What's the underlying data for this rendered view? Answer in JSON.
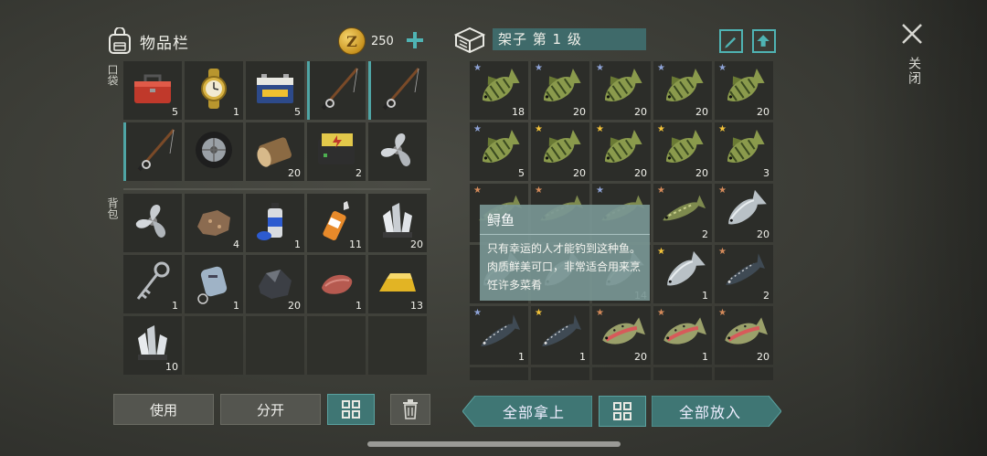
{
  "inventory": {
    "title": "物品栏",
    "coins": "250",
    "coin_symbol": "Z",
    "pocket_label": "口袋",
    "backpack_label": "背包",
    "pocket_items": [
      {
        "icon": "toolbox-icon",
        "count": "5"
      },
      {
        "icon": "wristwatch-icon",
        "count": "1"
      },
      {
        "icon": "battery-icon",
        "count": "5"
      },
      {
        "icon": "fishing-rod-icon",
        "count": ""
      },
      {
        "icon": "fishing-rod-icon",
        "count": ""
      },
      {
        "icon": "fishing-rod-icon",
        "count": ""
      },
      {
        "icon": "wheel-icon",
        "count": ""
      },
      {
        "icon": "log-icon",
        "count": "20"
      },
      {
        "icon": "electronic-device-icon",
        "count": "2"
      },
      {
        "icon": "propeller-icon",
        "count": ""
      }
    ],
    "backpack_items": [
      {
        "icon": "propeller-icon",
        "count": ""
      },
      {
        "icon": "ore-rock-icon",
        "count": "4"
      },
      {
        "icon": "spray-can-icon",
        "count": "1"
      },
      {
        "icon": "glue-bottle-icon",
        "count": "11"
      },
      {
        "icon": "crystal-icon",
        "count": "20"
      },
      {
        "icon": "key-icon",
        "count": "1"
      },
      {
        "icon": "dog-tag-icon",
        "count": "1"
      },
      {
        "icon": "coal-icon",
        "count": "20"
      },
      {
        "icon": "sausage-icon",
        "count": "1"
      },
      {
        "icon": "gold-bar-icon",
        "count": "13"
      },
      {
        "icon": "crystal-icon",
        "count": "10"
      },
      {
        "icon": "",
        "count": ""
      },
      {
        "icon": "",
        "count": ""
      },
      {
        "icon": "",
        "count": ""
      },
      {
        "icon": "",
        "count": ""
      }
    ],
    "buttons": {
      "use": "使用",
      "split": "分开"
    }
  },
  "shelf": {
    "title": "架子 第 1 级",
    "items": [
      {
        "fish": "perch",
        "star": "blue",
        "count": "18"
      },
      {
        "fish": "perch",
        "star": "blue",
        "count": "20"
      },
      {
        "fish": "perch",
        "star": "blue",
        "count": "20"
      },
      {
        "fish": "perch",
        "star": "blue",
        "count": "20"
      },
      {
        "fish": "perch",
        "star": "blue",
        "count": "20"
      },
      {
        "fish": "perch",
        "star": "blue",
        "count": "5"
      },
      {
        "fish": "perch",
        "star": "gold",
        "count": "20"
      },
      {
        "fish": "perch",
        "star": "gold",
        "count": "20"
      },
      {
        "fish": "perch",
        "star": "gold",
        "count": "20"
      },
      {
        "fish": "perch",
        "star": "gold",
        "count": "3"
      },
      {
        "fish": "pike",
        "star": "bronze",
        "count": ""
      },
      {
        "fish": "pike",
        "star": "bronze",
        "count": ""
      },
      {
        "fish": "pike",
        "star": "blue",
        "count": ""
      },
      {
        "fish": "pike",
        "star": "bronze",
        "count": "2"
      },
      {
        "fish": "salmon",
        "star": "bronze",
        "count": "20"
      },
      {
        "fish": "salmon",
        "star": "",
        "count": ""
      },
      {
        "fish": "salmon",
        "star": "",
        "count": ""
      },
      {
        "fish": "salmon",
        "star": "",
        "count": "14"
      },
      {
        "fish": "salmon",
        "star": "gold",
        "count": "1"
      },
      {
        "fish": "sturgeon",
        "star": "bronze",
        "count": "2"
      },
      {
        "fish": "sturgeon",
        "star": "blue",
        "count": "1"
      },
      {
        "fish": "sturgeon",
        "star": "gold",
        "count": "1"
      },
      {
        "fish": "trout",
        "star": "bronze",
        "count": "20"
      },
      {
        "fish": "trout",
        "star": "bronze",
        "count": "1"
      },
      {
        "fish": "trout",
        "star": "bronze",
        "count": "20"
      }
    ],
    "buttons": {
      "take_all": "全部拿上",
      "put_all": "全部放入"
    }
  },
  "tooltip": {
    "title": "鲟鱼",
    "desc": "只有幸运的人才能钓到这种鱼。肉质鲜美可口，非常适合用来烹饪许多菜肴"
  },
  "close_label": "关闭",
  "colors": {
    "accent": "#4fb3b3",
    "star_gold": "#f2c23a",
    "star_blue": "#8fa4d8",
    "star_bronze": "#d48a5a"
  }
}
